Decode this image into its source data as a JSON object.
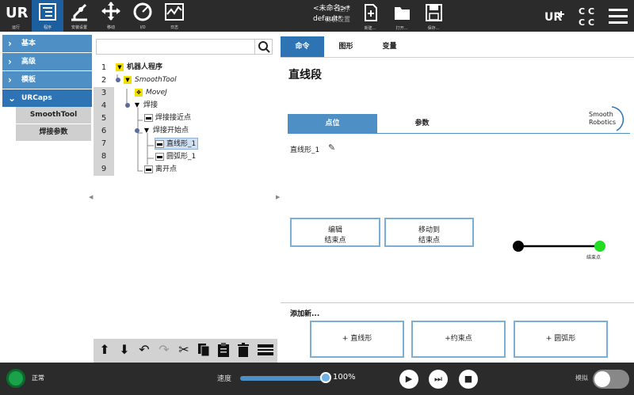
{
  "topbar": {
    "buttons": [
      {
        "label": "运行",
        "icon": "ur-logo-icon"
      },
      {
        "label": "程序",
        "icon": "program-icon"
      },
      {
        "label": "安装设置",
        "icon": "robot-arm-icon"
      },
      {
        "label": "移动",
        "icon": "move-arrows-icon"
      },
      {
        "label": "I/O",
        "icon": "io-gauge-icon"
      },
      {
        "label": "日志",
        "icon": "log-chart-icon"
      }
    ],
    "program_label": "程序",
    "program_value": "<未命名>*",
    "install_label": "安装设置",
    "install_value": "default*",
    "file_buttons": [
      {
        "label": "新建...",
        "icon": "new-file-icon"
      },
      {
        "label": "打开...",
        "icon": "open-folder-icon"
      },
      {
        "label": "保存...",
        "icon": "save-icon"
      }
    ]
  },
  "left_panel": {
    "categories": [
      {
        "label": "基本"
      },
      {
        "label": "高级"
      },
      {
        "label": "模板"
      },
      {
        "label": "URCaps"
      }
    ],
    "urcaps_items": [
      "SmoothTool",
      "焊接参数"
    ]
  },
  "tree": {
    "search_placeholder": "",
    "line_numbers": [
      "1",
      "2",
      "3",
      "4",
      "5",
      "6",
      "7",
      "8",
      "9"
    ],
    "nodes": [
      {
        "label": "机器人程序"
      },
      {
        "label": "SmoothTool"
      },
      {
        "label": "MoveJ"
      },
      {
        "label": "焊接"
      },
      {
        "label": "焊接接近点"
      },
      {
        "label": "焊接开始点"
      },
      {
        "label": "直线形_1"
      },
      {
        "label": "圆弧形_1"
      },
      {
        "label": "离开点"
      }
    ]
  },
  "right_panel": {
    "tabs": [
      "命令",
      "图形",
      "变量"
    ],
    "heading": "直线段",
    "subtabs": [
      "点位",
      "参数"
    ],
    "logo_line1": "Smooth",
    "logo_line2": "Robotics",
    "waypoint_name": "直线形_1",
    "edit_button_line1": "编辑",
    "edit_button_line2": "结束点",
    "move_button_line1": "移动到",
    "move_button_line2": "结束点",
    "diagram_end_label": "结束点",
    "add_new_label": "添加新...",
    "add_buttons": [
      "+ 直线形",
      "+约束点",
      "+ 圆弧形"
    ]
  },
  "bottombar": {
    "status_label": "正常",
    "speed_label": "速度",
    "speed_value": "100%",
    "speed_fraction": 1.0,
    "sim_label": "模拟"
  },
  "colors": {
    "active_blue": "#2e73b4",
    "accent_blue": "#4e8fc6",
    "status_green": "#1aa14a",
    "end_point_green": "#22dd22"
  }
}
